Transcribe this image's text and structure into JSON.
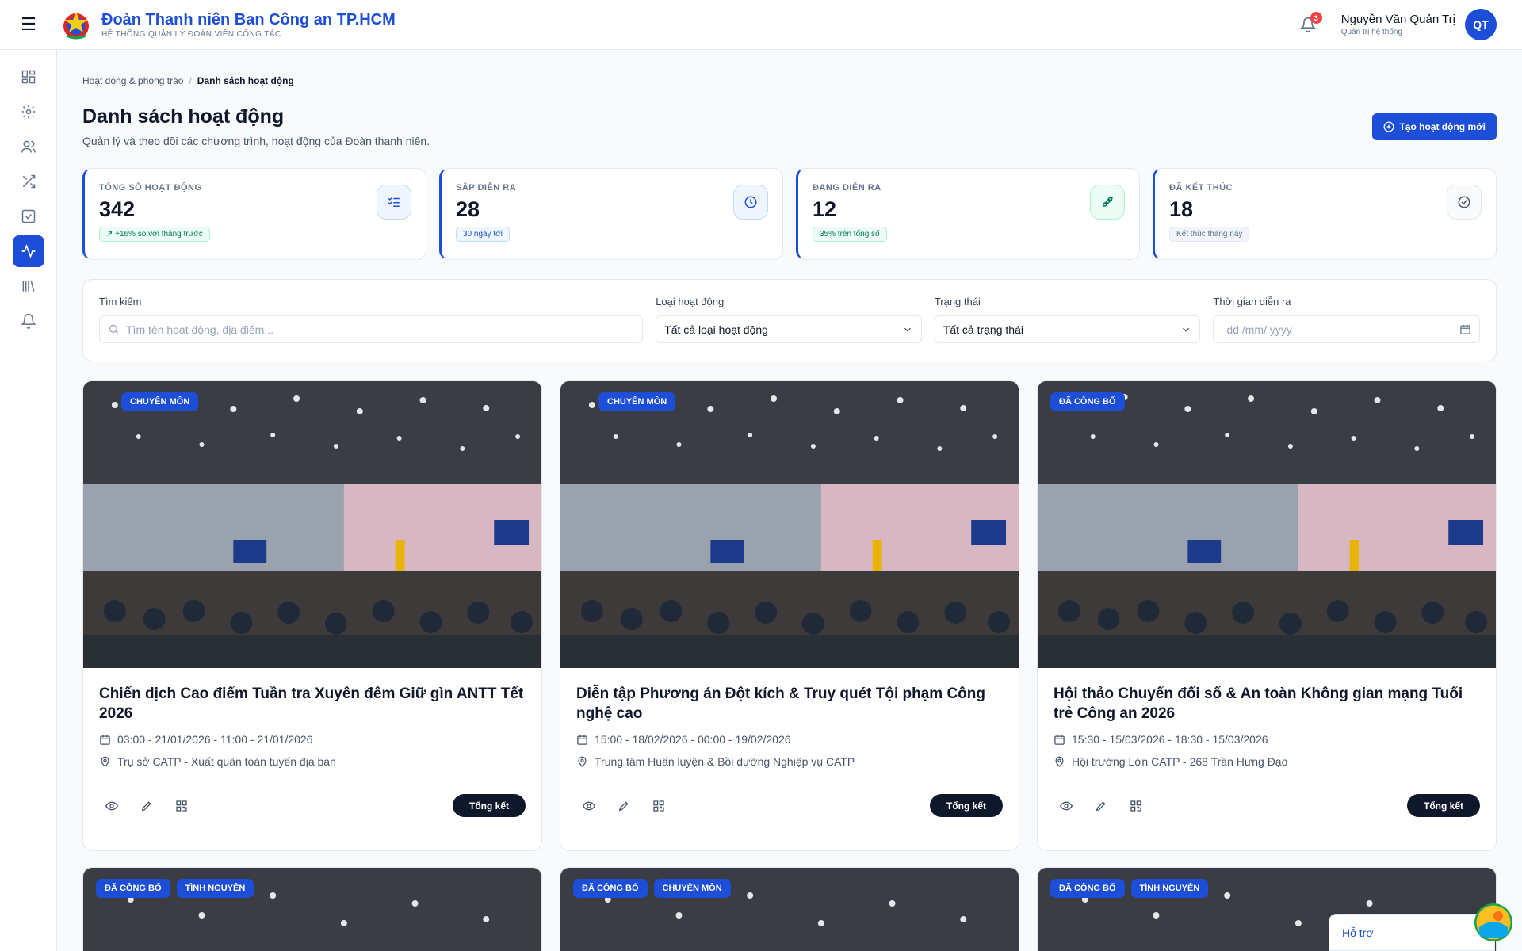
{
  "header": {
    "brand_title": "Đoàn Thanh niên Ban Công an TP.HCM",
    "brand_subtitle": "HỆ THỐNG QUẢN LÝ ĐOÀN VIÊN CÔNG TÁC",
    "notification_count": "3",
    "user_name": "Nguyễn Văn Quản Trị",
    "user_role": "Quản trị hệ thống",
    "avatar_initials": "QT"
  },
  "sidebar": {
    "items": [
      {
        "icon": "dashboard-icon"
      },
      {
        "icon": "gear-icon"
      },
      {
        "icon": "users-icon"
      },
      {
        "icon": "shuffle-icon"
      },
      {
        "icon": "checkbox-icon"
      },
      {
        "icon": "activity-icon",
        "active": true
      },
      {
        "icon": "library-icon"
      },
      {
        "icon": "bell-icon"
      }
    ]
  },
  "breadcrumb": {
    "parent": "Hoạt động & phong trào",
    "separator": "/",
    "current": "Danh sách hoạt động"
  },
  "page": {
    "title": "Danh sách hoạt động",
    "subtitle": "Quản lý và theo dõi các chương trình, hoạt động của Đoàn thanh niên.",
    "create_button": "Tạo hoạt động mới"
  },
  "stats": [
    {
      "label": "TỔNG SỐ HOẠT ĐỘNG",
      "value": "342",
      "chip": "+16% so với tháng trước",
      "icon": "checklist-icon"
    },
    {
      "label": "SẮP DIỄN RA",
      "value": "28",
      "chip": "30 ngày tới",
      "icon": "clock-icon"
    },
    {
      "label": "ĐANG DIỄN RA",
      "value": "12",
      "chip": "35% trên tổng số",
      "icon": "rocket-icon"
    },
    {
      "label": "ĐÃ KẾT THÚC",
      "value": "18",
      "chip": "Kết thúc tháng này",
      "icon": "check-circle-icon"
    }
  ],
  "filters": {
    "search_label": "Tìm kiếm",
    "search_placeholder": "Tìm tên hoạt động, địa điểm...",
    "type_label": "Loại hoạt động",
    "type_value": "Tất cả loại hoạt động",
    "status_label": "Trạng thái",
    "status_value": "Tất cả trạng thái",
    "date_label": "Thời gian diễn ra",
    "date_placeholder": "dd /mm/ yyyy"
  },
  "cards": [
    {
      "tags": [
        "CHUYÊN MÔN"
      ],
      "title": "Chiến dịch Cao điểm Tuần tra Xuyên đêm Giữ gìn ANTT Tết 2026",
      "time": "03:00 - 21/01/2026 - 11:00 - 21/01/2026",
      "place": "Trụ sở CATP - Xuất quân toàn tuyến địa bàn",
      "button": "Tổng kết"
    },
    {
      "tags": [
        "CHUYÊN MÔN"
      ],
      "title": "Diễn tập Phương án Đột kích & Truy quét Tội phạm Công nghệ cao",
      "time": "15:00 - 18/02/2026 - 00:00 - 19/02/2026",
      "place": "Trung tâm Huấn luyện & Bồi dưỡng Nghiệp vụ CATP",
      "button": "Tổng kết"
    },
    {
      "tags": [
        "ĐÃ CÔNG BỐ"
      ],
      "title": "Hội thảo Chuyển đổi số & An toàn Không gian mạng Tuổi trẻ Công an 2026",
      "time": "15:30 - 15/03/2026 - 18:30 - 15/03/2026",
      "place": "Hội trường Lớn CATP - 268 Trần Hưng Đạo",
      "button": "Tổng kết"
    },
    {
      "tags": [
        "ĐÃ CÔNG BỐ",
        "TÌNH NGUYỆN"
      ]
    },
    {
      "tags": [
        "ĐÃ CÔNG BỐ",
        "CHUYÊN MÔN"
      ]
    },
    {
      "tags": [
        "ĐÃ CÔNG BỐ",
        "TÌNH NGUYỆN"
      ]
    }
  ],
  "support": {
    "label": "Hỗ trợ"
  },
  "colors": {
    "primary": "#1d4ed8",
    "dark": "#0f172a",
    "green": "#047857"
  }
}
